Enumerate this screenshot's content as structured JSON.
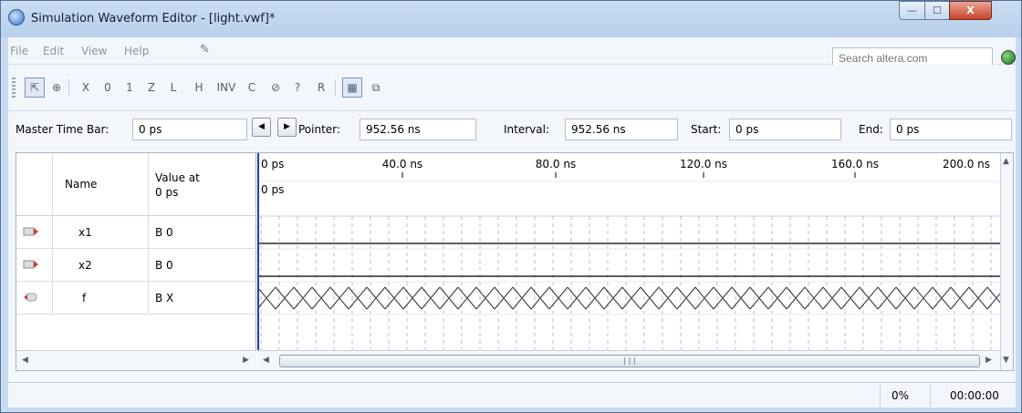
{
  "window": {
    "title": "Simulation Waveform Editor - [light.vwf]*",
    "controls": {
      "minimize": "—",
      "maximize": "☐",
      "close": "X"
    }
  },
  "menu": {
    "items": [
      "File",
      "Edit",
      "View",
      "Help"
    ],
    "search_placeholder": "Search altera.com"
  },
  "toolbar": {
    "tools": [
      {
        "name": "selection-tool-icon",
        "glyph": "⇱",
        "active": true
      },
      {
        "name": "zoom-tool-icon",
        "glyph": "⊕"
      },
      {
        "name": "force-unknown-icon",
        "glyph": "X"
      },
      {
        "name": "force-low-icon",
        "glyph": "0"
      },
      {
        "name": "force-high-icon",
        "glyph": "1"
      },
      {
        "name": "force-high-impedance-icon",
        "glyph": "Z"
      },
      {
        "name": "weak-low-icon",
        "glyph": "L"
      },
      {
        "name": "weak-high-icon",
        "glyph": "H"
      },
      {
        "name": "invert-icon",
        "glyph": "INV"
      },
      {
        "name": "count-value-icon",
        "glyph": "C"
      },
      {
        "name": "clock-icon",
        "glyph": "⊘"
      },
      {
        "name": "arbitrary-value-icon",
        "glyph": "?"
      },
      {
        "name": "random-value-icon",
        "glyph": "R"
      },
      {
        "name": "snap-to-grid-icon",
        "glyph": "▦",
        "active": true
      },
      {
        "name": "sort-icon",
        "glyph": "⧉"
      }
    ]
  },
  "timebar": {
    "master_label": "Master Time Bar:",
    "master_value": "0 ps",
    "pointer_label": "Pointer:",
    "pointer_value": "952.56 ns",
    "interval_label": "Interval:",
    "interval_value": "952.56 ns",
    "start_label": "Start:",
    "start_value": "0 ps",
    "end_label": "End:",
    "end_value": "0 ps"
  },
  "grid": {
    "col_name": "Name",
    "col_value_line1": "Value at",
    "col_value_line2": "0 ps",
    "signals": [
      {
        "name": "x1",
        "value": "B 0",
        "kind": "input",
        "wave": "low"
      },
      {
        "name": "x2",
        "value": "B 0",
        "kind": "input",
        "wave": "low"
      },
      {
        "name": "f",
        "value": "B X",
        "kind": "output",
        "wave": "unknown"
      }
    ],
    "time_ticks": [
      "0 ps",
      "40.0 ns",
      "80.0 ns",
      "120.0 ns",
      "160.0 ns",
      "200.0 ns"
    ],
    "cursor_label": "0 ps"
  },
  "status": {
    "progress": "0%",
    "elapsed": "00:00:00"
  }
}
